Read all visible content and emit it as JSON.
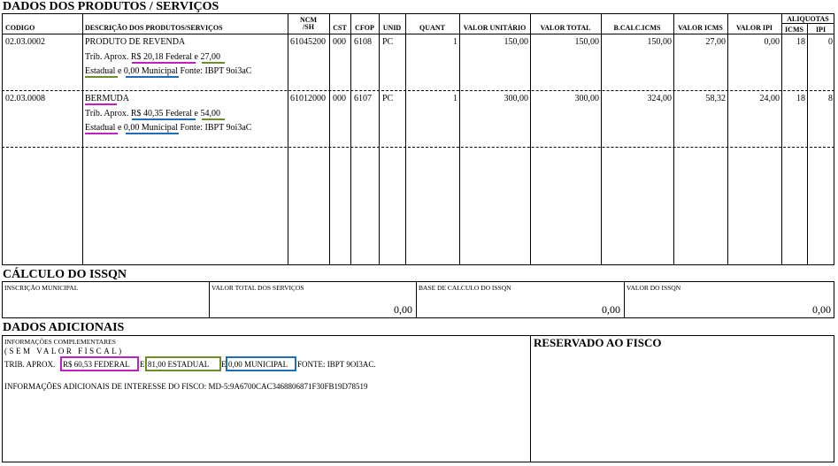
{
  "products": {
    "title": "DADOS DOS PRODUTOS / SERVIÇOS",
    "headers": {
      "codigo": "CODIGO",
      "descricao": "DESCRIÇÃO DOS PRODUTOS/SERVIÇOS",
      "ncm_1": "NCM",
      "ncm_2": "/SH",
      "cst": "CST",
      "cfop": "CFOP",
      "unid": "UNID",
      "quant": "QUANT",
      "valor_unitario": "VALOR UNITÁRIO",
      "valor_total": "VALOR TOTAL",
      "bcalc_icms": "B.CALC.ICMS",
      "valor_icms": "VALOR ICMS",
      "valor_ipi": "VALOR IPI",
      "aliquotas": "ALIQUOTAS",
      "icms": "ICMS",
      "ipi": "IPI"
    },
    "rows": [
      {
        "codigo": "02.03.0002",
        "descricao": "PRODUTO DE REVENDA",
        "trib_prefix": "Trib. Aprox.",
        "federal": "R$ 20,18 Federal",
        "e1": "e",
        "estadual_value": "27,00",
        "estadual_word": "Estadual",
        "e2": "e",
        "municipal": "0,00 Municipal",
        "fonte": "Fonte: IBPT  9oi3aC",
        "ncm": "61045200",
        "cst": "000",
        "cfop": "6108",
        "unid": "PC",
        "quant": "1",
        "valor_unitario": "150,00",
        "valor_total": "150,00",
        "bcalc_icms": "150,00",
        "valor_icms": "27,00",
        "valor_ipi": "0,00",
        "aliq_icms": "18",
        "aliq_ipi": "0"
      },
      {
        "codigo": "02.03.0008",
        "descricao": "BERMUDA",
        "trib_prefix": "Trib. Aprox.",
        "federal": "R$ 40,35 Federal",
        "e1": "e",
        "estadual_value": "54,00",
        "estadual_word": "Estadual",
        "e2": "e",
        "municipal": "0,00 Municipal",
        "fonte": "Fonte: IBPT  9oi3aC",
        "ncm": "61012000",
        "cst": "000",
        "cfop": "6107",
        "unid": "PC",
        "quant": "1",
        "valor_unitario": "300,00",
        "valor_total": "300,00",
        "bcalc_icms": "324,00",
        "valor_icms": "58,32",
        "valor_ipi": "24,00",
        "aliq_icms": "18",
        "aliq_ipi": "8"
      }
    ]
  },
  "issqn": {
    "title": "CÁLCULO DO ISSQN",
    "inscricao_label": "INSCRIÇÃO MUNICIPAL",
    "valor_total_label": "VALOR TOTAL DOS SERVIÇOS",
    "valor_total_value": "0,00",
    "base_label": "BASE DE CALCULO DO ISSQN",
    "base_value": "0,00",
    "valor_issqn_label": "VALOR DO ISSQN",
    "valor_issqn_value": "0,00"
  },
  "adicionais": {
    "title": "DADOS ADICIONAIS",
    "info_label": "INFORMAÇÕES COMPLEMENTARES",
    "sem_valor": "(SEM VALOR FISCAL)",
    "trib_prefix": "TRIB. APROX.",
    "federal": "R$ 60,53 FEDERAL",
    "e1": "E",
    "estadual": "81,00 ESTADUAL",
    "e2": "E",
    "municipal": "0,00 MUNICIPAL",
    "fonte": "FONTE: IBPT 9OI3AC.",
    "fisco_info": "INFORMAÇÕES ADICIONAIS DE INTERESSE DO FISCO: MD-5:9A6700CAC3468806871F30FB19D78519",
    "reservado": "RESERVADO AO FISCO"
  },
  "colors": {
    "federal": "#c020c0",
    "estadual": "#6a8f2a",
    "municipal": "#1f6fb8"
  }
}
